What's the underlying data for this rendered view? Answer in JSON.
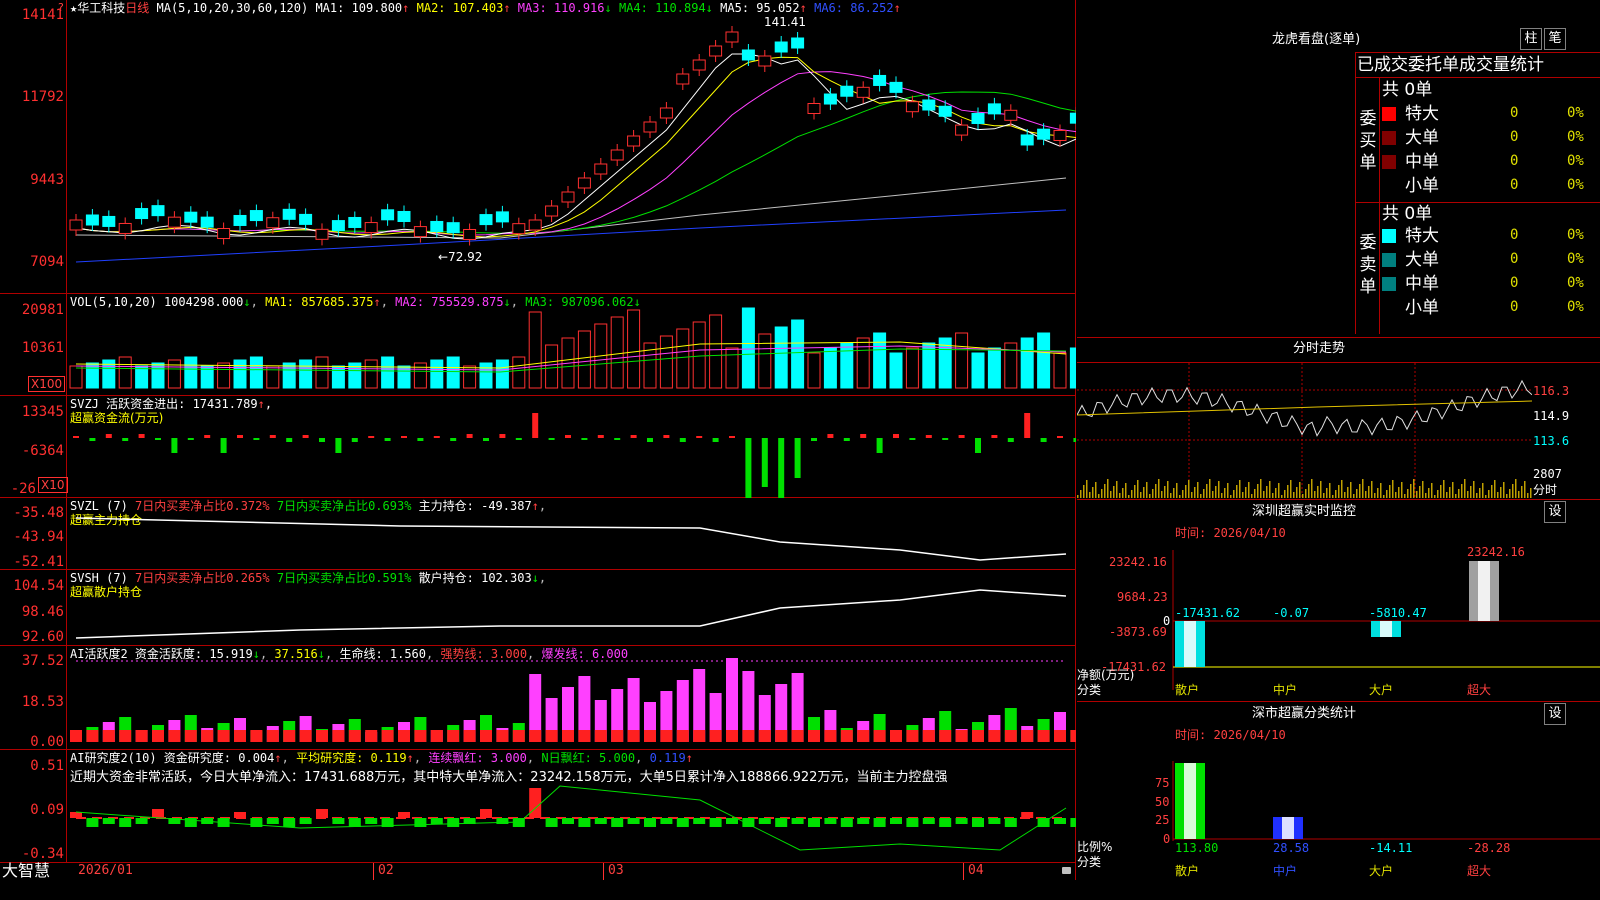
{
  "kline": {
    "header": {
      "star": "★",
      "name": "华工科技",
      "period": "日线",
      "ma_title": "MA(5,10,20,30,60,120)",
      "ma1": "MA1: 109.800",
      "ma2": "MA2: 107.403",
      "ma3": "MA3: 110.916",
      "ma4": "MA4: 110.894",
      "ma5": "MA5: 95.052",
      "ma6": "MA6: 86.252",
      "up": "↑",
      "down": "↓"
    },
    "y_ticks": [
      "14141",
      "11792",
      "9443",
      "7094"
    ],
    "high_label": "141.41",
    "low_label": "←72.92",
    "corner_mark": "?"
  },
  "vol": {
    "title": "VOL(5,10,20)",
    "value": "1004298.000",
    "ma1": "MA1: 857685.375",
    "ma2": "MA2: 755529.875",
    "ma3": "MA3: 987096.062",
    "y_ticks": [
      "20981",
      "10361"
    ],
    "unit": "X100"
  },
  "svzj": {
    "title": "SVZJ  活跃资金进出: 17431.789",
    "subtitle": "超赢资金流(万元)",
    "y_ticks": [
      "13345",
      "-6364",
      "-26"
    ],
    "unit": "X10"
  },
  "svzl": {
    "title": "SVZL (7)",
    "t1": "7日内买卖净占比0.372%",
    "t2": "7日内买卖净占比0.693%",
    "t3": "主力持仓: -49.387",
    "subtitle": "超赢主力持仓",
    "y_ticks": [
      "-35.48",
      "-43.94",
      "-52.41"
    ]
  },
  "svsh": {
    "title": "SVSH (7)",
    "t1": "7日内买卖净占比0.265%",
    "t2": "7日内买卖净占比0.591%",
    "t3": "散户持仓: 102.303",
    "subtitle": "超赢散户持仓",
    "y_ticks": [
      "104.54",
      "98.46",
      "92.60"
    ]
  },
  "ai1": {
    "title": "AI活跃度2 资金活跃度: 15.919",
    "t2": "37.516",
    "t3": "生命线: 1.560",
    "t4": "强势线: 3.000",
    "t5": "爆发线: 6.000",
    "y_ticks": [
      "37.52",
      "18.53",
      "0.00"
    ]
  },
  "ai2": {
    "title": "AI研究度2(10) 资金研究度: 0.004",
    "t2": "平均研究度: 0.119",
    "t3": "连续飘红: 3.000",
    "t4": "N日飘红: 5.000",
    "t5": "0.119",
    "summary": "近期大资金非常活跃，今日大单净流入：17431.688万元，其中特大单净流入：23242.158万元，大单5日累计净入188866.922万元，当前主力控盘强",
    "y_ticks": [
      "0.51",
      "0.09",
      "-0.34"
    ]
  },
  "xaxis": {
    "brand": "大智慧",
    "labels": [
      "2026/01",
      "02",
      "03",
      "04"
    ]
  },
  "right": {
    "dragon_title": "龙虎看盘(逐单)",
    "btn1": "柱",
    "btn2": "笔",
    "stats_title": "已成交委托单成交量统计",
    "buy_side": {
      "vlabel": [
        "委",
        "买",
        "单"
      ],
      "total": "共 0单",
      "rows": [
        {
          "label": "特大",
          "count": "0",
          "pct": "0%"
        },
        {
          "label": "大单",
          "count": "0",
          "pct": "0%"
        },
        {
          "label": "中单",
          "count": "0",
          "pct": "0%"
        },
        {
          "label": "小单",
          "count": "0",
          "pct": "0%"
        }
      ]
    },
    "sell_side": {
      "vlabel": [
        "委",
        "卖",
        "单"
      ],
      "total": "共 0单",
      "rows": [
        {
          "label": "特大",
          "count": "0",
          "pct": "0%"
        },
        {
          "label": "大单",
          "count": "0",
          "pct": "0%"
        },
        {
          "label": "中单",
          "count": "0",
          "pct": "0%"
        },
        {
          "label": "小单",
          "count": "0",
          "pct": "0%"
        }
      ]
    },
    "colors": {
      "buy_xl": "#ff0000",
      "buy_l": "#800000",
      "buy_m": "#800000",
      "sell_xl": "#00ffff",
      "sell_l": "#008080",
      "sell_m": "#008080"
    },
    "intraday": {
      "title": "分时走势",
      "y_ticks": [
        "116.3",
        "114.9",
        "113.6"
      ],
      "vol_tick": "2807",
      "vol_unit": "分时"
    },
    "monitor": {
      "title": "深圳超赢实时监控",
      "set": "设",
      "time": "时间: 2026/04/10",
      "y_ticks": [
        "23242.16",
        "9684.23",
        "0",
        "-3873.69",
        "-17431.62"
      ],
      "top_value": "23242.16",
      "values": [
        "-17431.62",
        "-0.07",
        "-5810.47"
      ],
      "ylabel": "净额(万元)",
      "xlabel": "分类",
      "categories": [
        "散户",
        "中户",
        "大户",
        "超大"
      ]
    },
    "classify": {
      "title": "深市超赢分类统计",
      "set": "设",
      "time": "时间: 2026/04/10",
      "y_ticks": [
        "75",
        "50",
        "25",
        "0"
      ],
      "ylabel": "比例%",
      "xlabel": "分类",
      "values": [
        "113.80",
        "28.58",
        "-14.11",
        "-28.28"
      ],
      "categories": [
        "散户",
        "中户",
        "大户",
        "超大"
      ]
    }
  }
}
